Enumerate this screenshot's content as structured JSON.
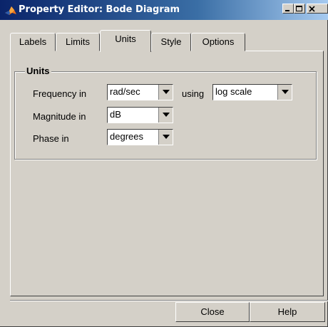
{
  "window": {
    "title": "Property Editor: Bode Diagram",
    "controls": {
      "minimize": "minimize",
      "maximize": "maximize",
      "close": "close"
    }
  },
  "tabs": [
    {
      "label": "Labels",
      "active": false
    },
    {
      "label": "Limits",
      "active": false
    },
    {
      "label": "Units",
      "active": true
    },
    {
      "label": "Style",
      "active": false
    },
    {
      "label": "Options",
      "active": false
    }
  ],
  "units_group": {
    "title": "Units",
    "frequency": {
      "label": "Frequency in",
      "value": "rad/sec",
      "using_label": "using",
      "scale_value": "log scale"
    },
    "magnitude": {
      "label": "Magnitude in",
      "value": "dB"
    },
    "phase": {
      "label": "Phase in",
      "value": "degrees"
    }
  },
  "buttons": {
    "close": "Close",
    "help": "Help"
  }
}
